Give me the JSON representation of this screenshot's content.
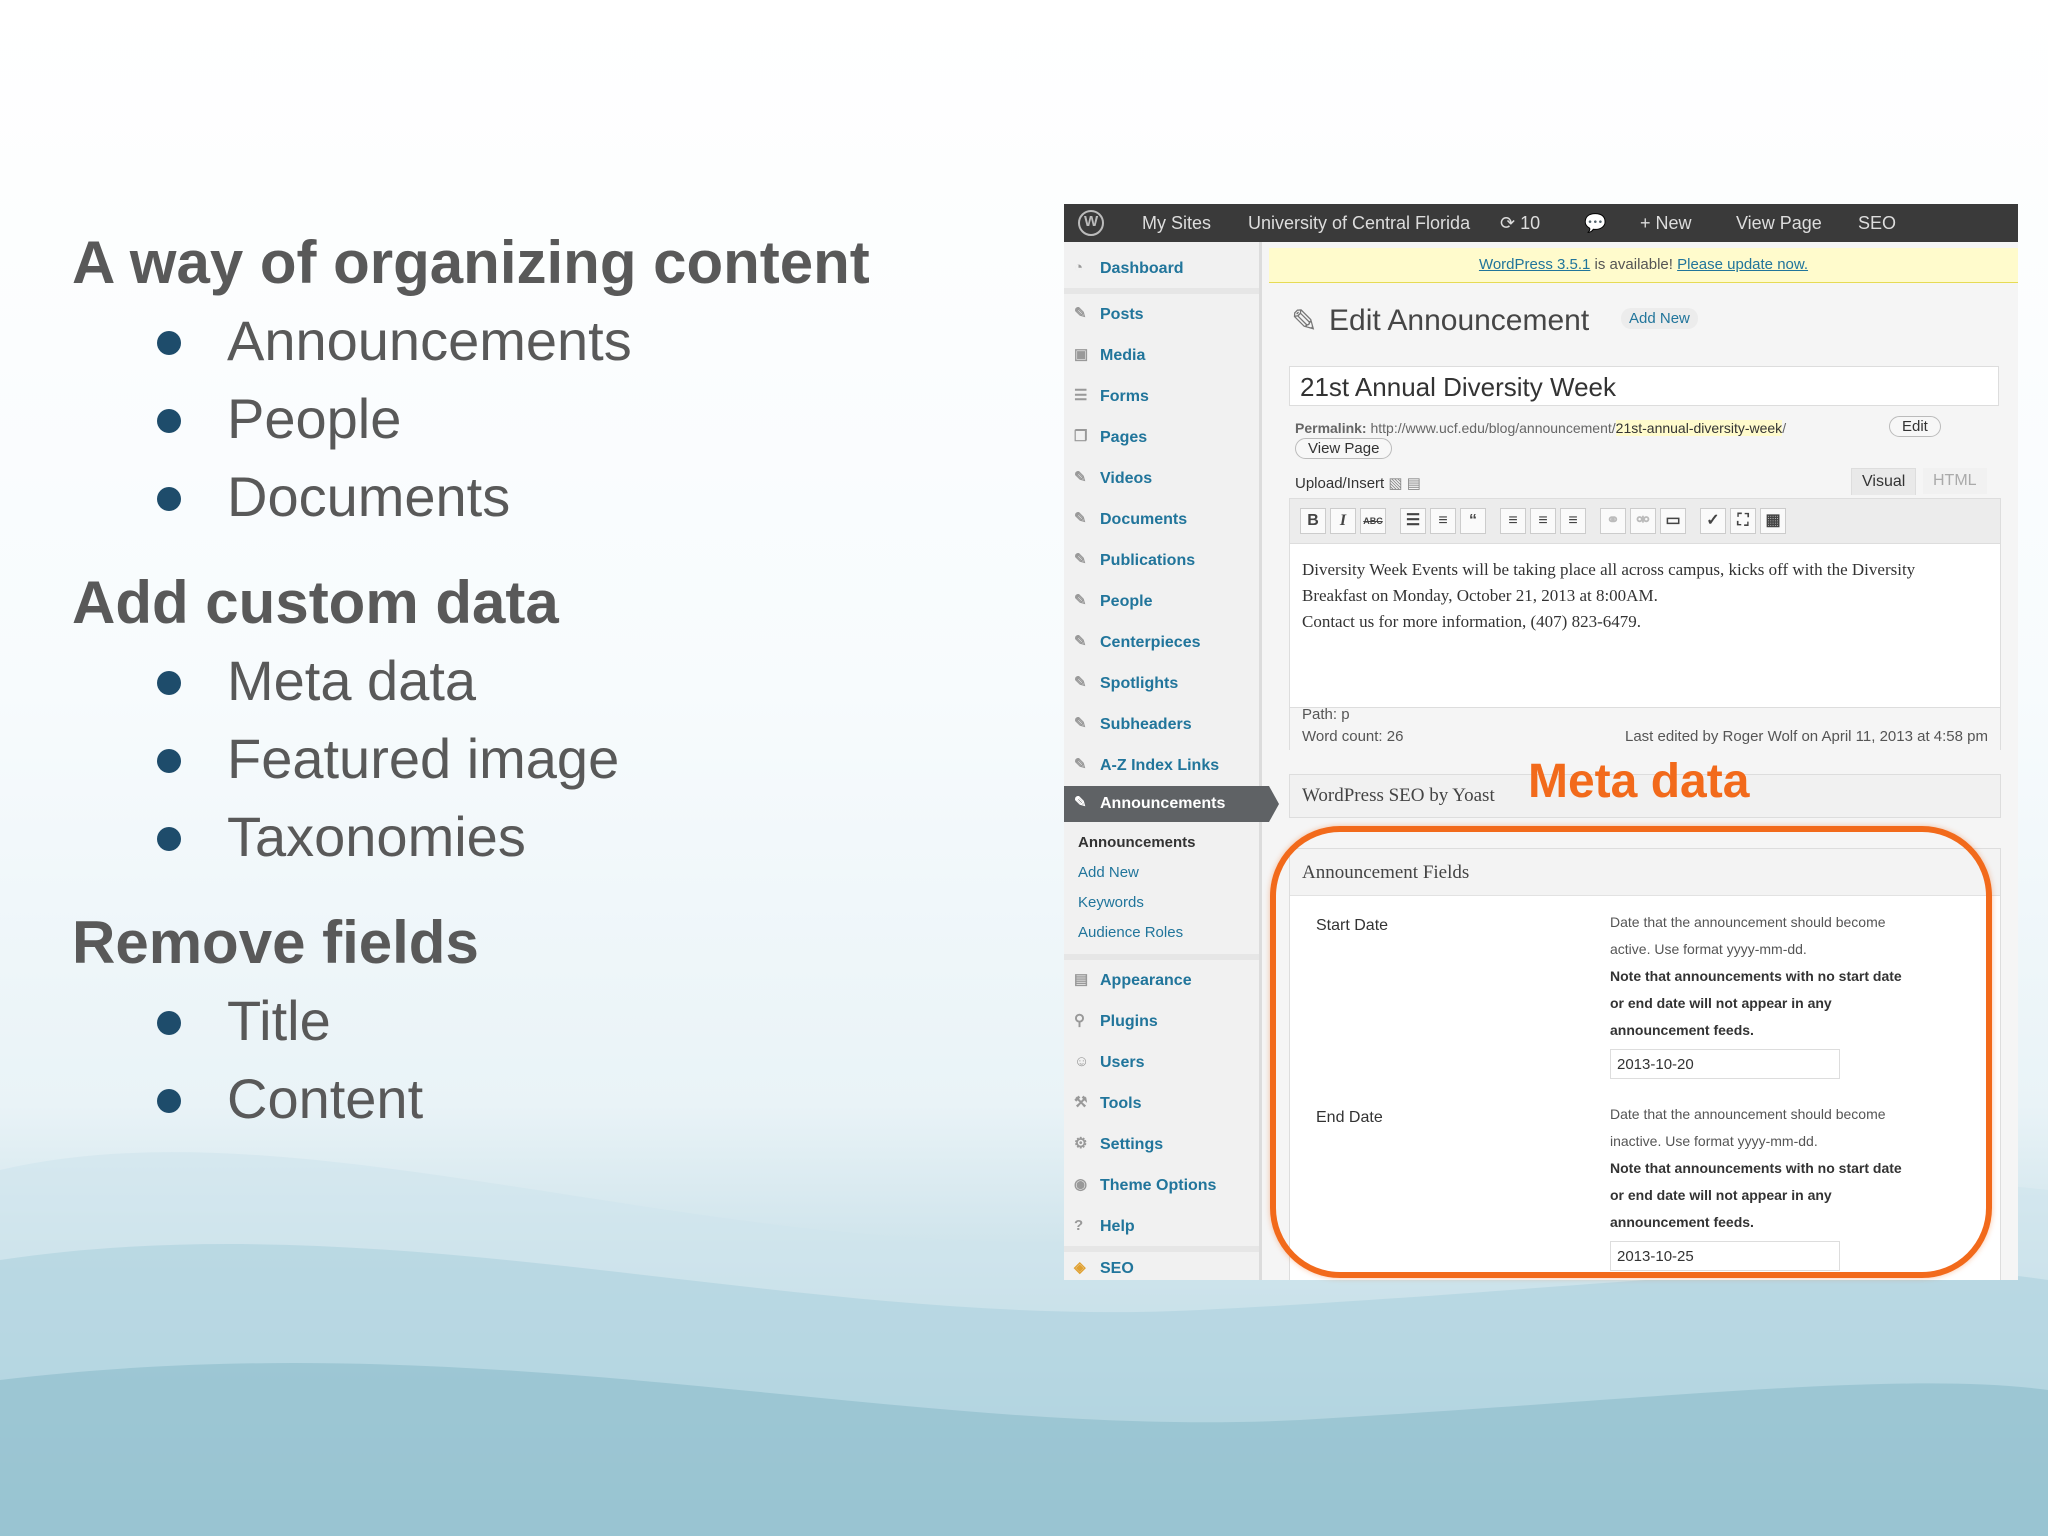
{
  "outline": [
    {
      "heading": "A way of organizing content",
      "items": [
        "Announcements",
        "People",
        "Documents"
      ]
    },
    {
      "heading": "Add custom data",
      "items": [
        "Meta data",
        "Featured image",
        "Taxonomies"
      ]
    },
    {
      "heading": "Remove fields",
      "items": [
        "Title",
        "Content"
      ]
    }
  ],
  "callout": "Meta data",
  "wp": {
    "adminbar": {
      "my_sites": "My Sites",
      "site_name": "University of Central Florida",
      "updates": "10",
      "new": "New",
      "view_page": "View Page",
      "seo": "SEO"
    },
    "menu": {
      "dashboard": "Dashboard",
      "posts": "Posts",
      "media": "Media",
      "forms": "Forms",
      "pages": "Pages",
      "videos": "Videos",
      "documents": "Documents",
      "publications": "Publications",
      "people": "People",
      "centerpieces": "Centerpieces",
      "spotlights": "Spotlights",
      "subheaders": "Subheaders",
      "az_index": "A-Z Index Links",
      "announcements": "Announcements",
      "sub_announcements": "Announcements",
      "sub_add_new": "Add New",
      "sub_keywords": "Keywords",
      "sub_audience": "Audience Roles",
      "appearance": "Appearance",
      "plugins": "Plugins",
      "users": "Users",
      "tools": "Tools",
      "settings": "Settings",
      "theme_options": "Theme Options",
      "help": "Help",
      "seo": "SEO"
    },
    "notice": {
      "version_link": "WordPress 3.5.1",
      "text": " is available! ",
      "update_link": "Please update now."
    },
    "page_title": "Edit Announcement",
    "add_new": "Add New",
    "post_title": "21st Annual Diversity Week",
    "permalink_label": "Permalink:",
    "permalink_base": "http://www.ucf.edu/blog/announcement/",
    "permalink_slug": "21st-annual-diversity-week",
    "permalink_end": "/",
    "edit_btn": "Edit",
    "view_page_btn": "View Page",
    "upload_insert": "Upload/Insert",
    "tab_visual": "Visual",
    "tab_html": "HTML",
    "toolbar": {
      "bold": "B",
      "italic": "I",
      "strike": "ABC",
      "quote": "“"
    },
    "body_line1": "Diversity Week Events will be taking place all across campus, kicks off with the Diversity",
    "body_line2": "Breakfast on Monday, October 21, 2013 at 8:00AM.",
    "body_line3": "Contact us for more information, (407) 823-6479.",
    "path": "Path: p",
    "word_count": "Word count: 26",
    "last_edited": "Last edited by Roger Wolf on April 11, 2013 at 4:58 pm",
    "seo_box": "WordPress SEO by Yoast",
    "ann_fields": "Announcement Fields",
    "start_label": "Start Date",
    "start_desc1": "Date that the announcement should become",
    "start_desc2": "active. Use format yyyy-mm-dd.",
    "start_note1": "Note that announcements with no start date",
    "start_note2": "or end date will not appear in any",
    "start_note3": "announcement feeds.",
    "start_value": "2013-10-20",
    "end_label": "End Date",
    "end_desc1": "Date that the announcement should become",
    "end_desc2": "inactive. Use format yyyy-mm-dd.",
    "end_note1": "Note that announcements with no start date",
    "end_note2": "or end date will not appear in any",
    "end_note3": "announcement feeds.",
    "end_value": "2013-10-25"
  }
}
